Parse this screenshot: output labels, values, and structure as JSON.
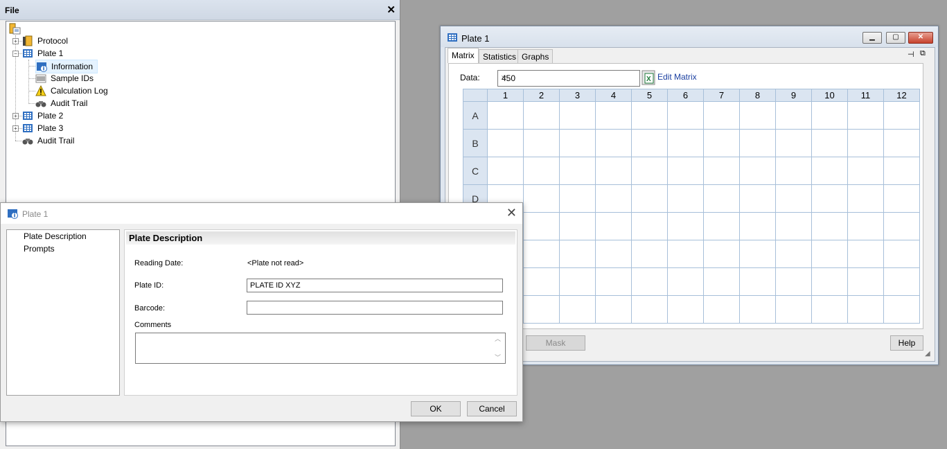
{
  "file_panel": {
    "title": "File",
    "close_glyph": "✕",
    "tree": [
      {
        "label": "Protocol",
        "icon": "protocol-folder-icon"
      },
      {
        "label": "Plate 1",
        "icon": "plate-icon"
      },
      {
        "label": "Information",
        "icon": "information-icon"
      },
      {
        "label": "Sample IDs",
        "icon": "sample-ids-icon"
      },
      {
        "label": "Calculation Log",
        "icon": "warning-icon"
      },
      {
        "label": "Audit Trail",
        "icon": "binoculars-icon"
      },
      {
        "label": "Plate 2",
        "icon": "plate-icon"
      },
      {
        "label": "Plate 3",
        "icon": "plate-icon"
      },
      {
        "label": "Audit Trail",
        "icon": "binoculars-icon"
      }
    ]
  },
  "plate_window": {
    "title": "Plate 1",
    "tabs": [
      "Matrix",
      "Statistics",
      "Graphs"
    ],
    "data_label": "Data:",
    "data_value": "450",
    "edit_matrix_label": "Edit Matrix",
    "columns": [
      "1",
      "2",
      "3",
      "4",
      "5",
      "6",
      "7",
      "8",
      "9",
      "10",
      "11",
      "12"
    ],
    "rows": [
      "A",
      "B",
      "C",
      "D"
    ],
    "mask_label": "Mask",
    "help_label": "Help"
  },
  "dialog": {
    "title": "Plate 1",
    "nav_items": [
      "Plate Description",
      "Prompts"
    ],
    "header": "Plate Description",
    "reading_date_label": "Reading Date:",
    "reading_date_value": "<Plate not read>",
    "plate_id_label": "Plate ID:",
    "plate_id_value": "PLATE ID XYZ",
    "barcode_label": "Barcode:",
    "barcode_value": "",
    "comments_label": "Comments",
    "comments_value": "",
    "ok_label": "OK",
    "cancel_label": "Cancel"
  },
  "colors": {
    "grid_header": "#dbe5f1",
    "grid_line": "#a7bfd9",
    "link": "#1a3fa0",
    "close_button": "#c7422d"
  }
}
